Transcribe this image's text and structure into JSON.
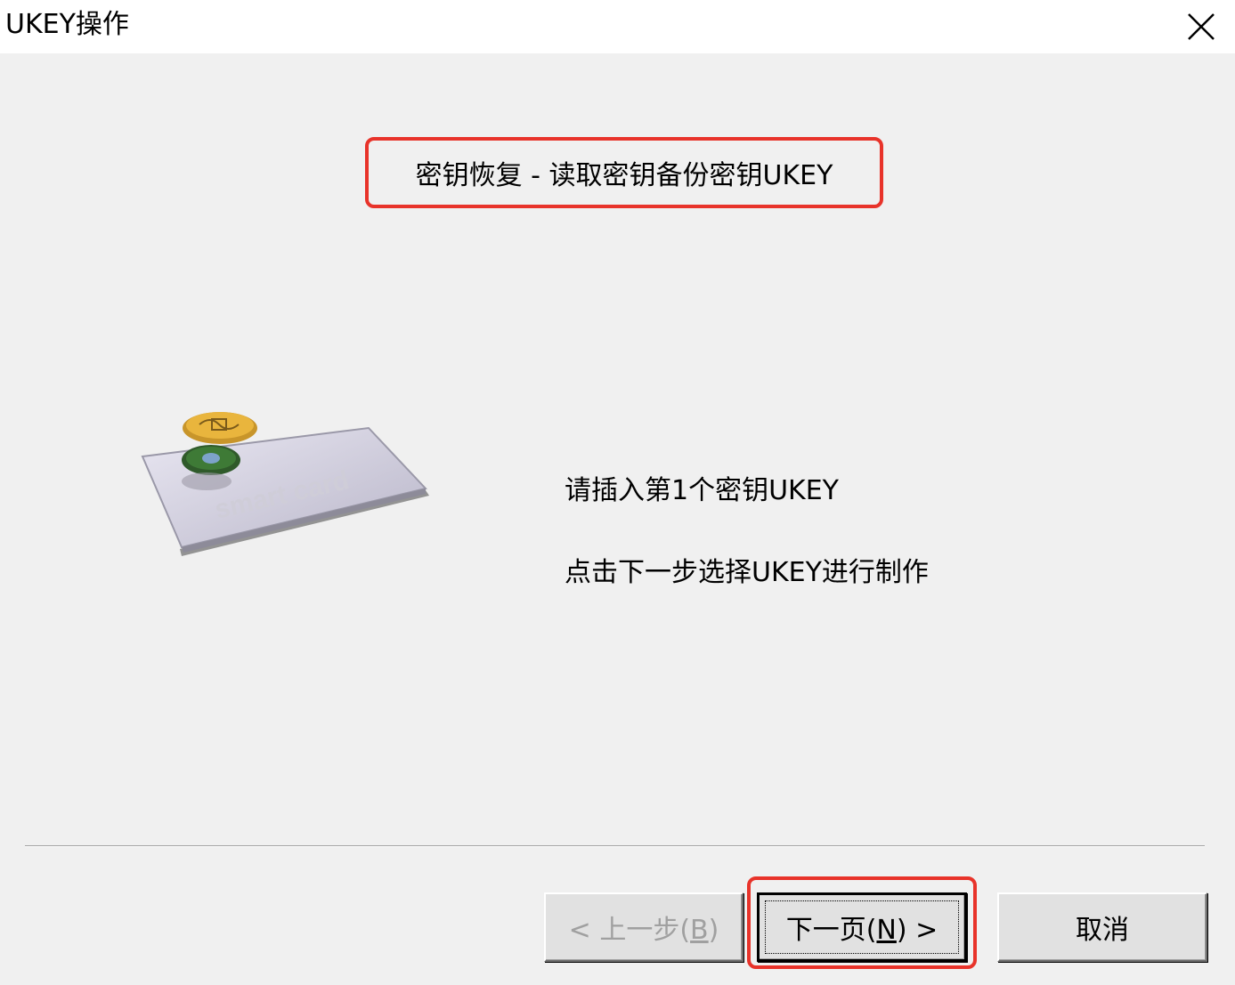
{
  "window": {
    "title": "UKEY操作",
    "close_icon": "close-icon"
  },
  "step_title": "密钥恢复 - 读取密钥备份密钥UKEY",
  "illustration": {
    "card_text": "smart card"
  },
  "instructions": {
    "line1": "请插入第1个密钥UKEY",
    "line2": "点击下一步选择UKEY进行制作"
  },
  "buttons": {
    "back": {
      "prefix": "< ",
      "label": "上一步(",
      "hotkey": "B",
      "suffix": ")"
    },
    "next": {
      "label": "下一页(",
      "hotkey": "N",
      "suffix": ")",
      "arrow": " >"
    },
    "cancel": "取消"
  },
  "colors": {
    "highlight": "#e8332a",
    "background": "#f0f0f0"
  }
}
